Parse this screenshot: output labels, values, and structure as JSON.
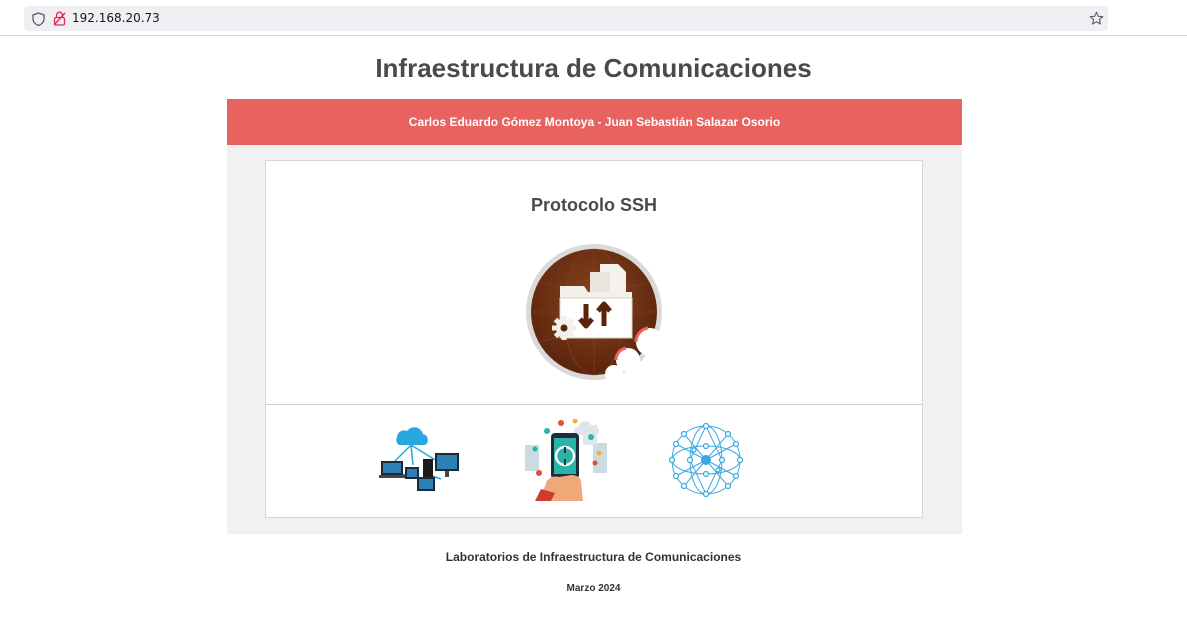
{
  "browser": {
    "url": "192.168.20.73",
    "icons": [
      "shield-icon",
      "insecure-lock-icon",
      "bookmark-star-icon"
    ]
  },
  "page": {
    "title": "Infraestructura de Comunicaciones",
    "authors": "Carlos Eduardo Gómez Montoya - Juan Sebastián Salazar Osorio",
    "card_heading": "Protocolo SSH",
    "footer_lab": "Laboratorios de Infraestructura de Comunicaciones",
    "footer_date": "Marzo 2024"
  },
  "colors": {
    "banner": "#e8625f",
    "panel_background": "#f1f1f1",
    "title_text": "#4a4a4a",
    "ssh_icon_brown": "#6b2e10"
  },
  "images": [
    "ssh-folder-icon",
    "network-devices-image",
    "mobile-connectivity-image",
    "network-globe-image"
  ]
}
